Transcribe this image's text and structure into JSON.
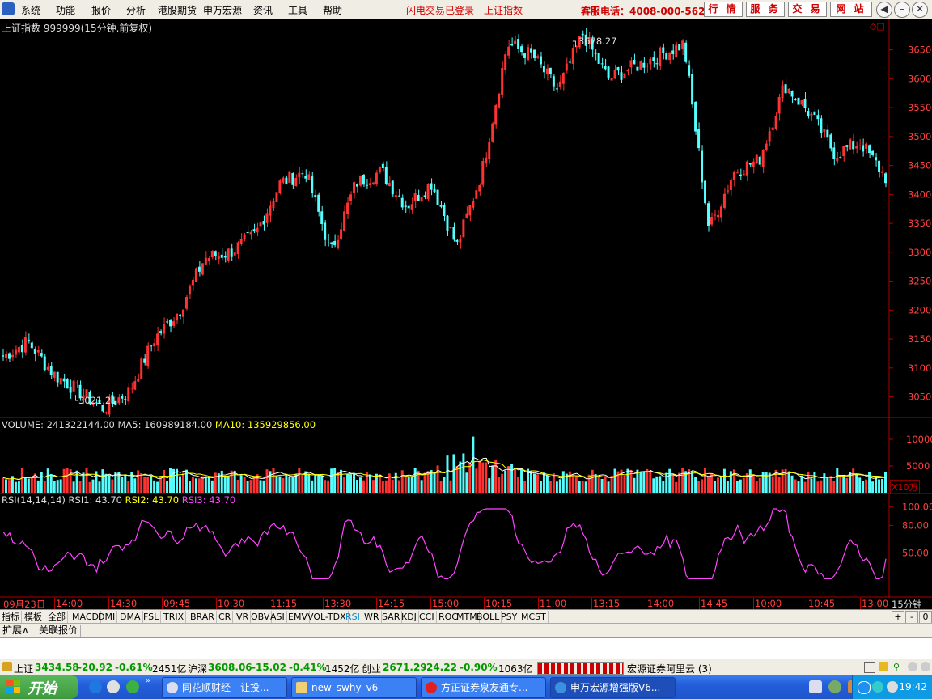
{
  "menu": {
    "items": [
      "系统",
      "功能",
      "报价",
      "分析",
      "港股期货",
      "申万宏源",
      "资讯",
      "工具",
      "帮助"
    ],
    "flash_login": "闪电交易已登录",
    "index_link": "上证指数",
    "hotline": "客服电话：4008-000-562",
    "buttons": [
      "行 情",
      "服 务",
      "交 易",
      "网 站"
    ]
  },
  "chart": {
    "stock_header": "上证指数 999999(15分钟.前复权)",
    "high_label": "3678.27",
    "low_label": "3021.21",
    "price_ticks": [
      "3650",
      "3600",
      "3550",
      "3500",
      "3450",
      "3400",
      "3350",
      "3300",
      "3250",
      "3200",
      "3150",
      "3100",
      "3050"
    ],
    "volume_header": {
      "vol": "VOLUME: 241322144.00",
      "ma5": "MA5: 160989184.00",
      "ma10": "MA10: 135929856.00"
    },
    "volume_ticks": [
      "10000",
      "5000"
    ],
    "volume_unit": "X10万",
    "rsi_header": {
      "params": "RSI(14,14,14)",
      "rsi1": "RSI1: 43.70",
      "rsi2": "RSI2: 43.70",
      "rsi3": "RSI3: 43.70"
    },
    "rsi_ticks": [
      "100.00",
      "80.00",
      "50.00"
    ],
    "time_labels": [
      "09月23日",
      "14:00",
      "14:30",
      "09:45",
      "10:30",
      "11:15",
      "13:30",
      "14:15",
      "15:00",
      "10:15",
      "11:00",
      "13:15",
      "14:00",
      "14:45",
      "10:00",
      "10:45",
      "13:00"
    ],
    "period": "15分钟",
    "colors": {
      "up": "#ff3232",
      "down": "#54ffff",
      "ma5": "#ffffff",
      "ma10": "#ffff00",
      "rsi": "#ff44ff",
      "axis": "#b00000"
    }
  },
  "chart_data": {
    "type": "candlestick",
    "title": "上证指数 999999(15分钟.前复权)",
    "high": 3678.27,
    "low": 3021.21,
    "close_path": [
      3120,
      3145,
      3090,
      3060,
      3030,
      3060,
      3150,
      3200,
      3290,
      3300,
      3330,
      3420,
      3440,
      3300,
      3420,
      3440,
      3380,
      3420,
      3310,
      3440,
      3660,
      3640,
      3580,
      3678,
      3600,
      3620,
      3640,
      3660,
      3340,
      3440,
      3460,
      3590,
      3540,
      3470,
      3490,
      3430
    ],
    "ylim": [
      3020,
      3690
    ],
    "last_volume": 241322144,
    "rsi": 43.7
  },
  "tabs": {
    "items": [
      "指标",
      "模板",
      "全部",
      "MACD",
      "DMI",
      "DMA",
      "FSL",
      "TRIX",
      "BRAR",
      "CR",
      "VR",
      "OBV",
      "ASI",
      "EMV",
      "VOL-TDX",
      "RSI",
      "WR",
      "SAR",
      "KDJ",
      "CCI",
      "ROC",
      "MTM",
      "BOLL",
      "PSY",
      "MCST"
    ],
    "active": "RSI",
    "right_buttons": [
      "+",
      "-",
      "0"
    ]
  },
  "ext": {
    "items": [
      "扩展∧",
      "关联报价"
    ]
  },
  "status": {
    "sh_name": "上证",
    "sh_value": "3434.58",
    "sh_change": "-20.92",
    "sh_pct": "-0.61%",
    "sh_amt": "2451亿",
    "hs_name": "沪深",
    "hs_value": "3608.06",
    "hs_change": "-15.02",
    "hs_pct": "-0.41%",
    "hs_amt": "1452亿",
    "cy_name": "创业",
    "cy_value": "2671.29",
    "cy_change": "-24.22",
    "cy_pct": "-0.90%",
    "cy_amt": "1063亿",
    "broker": "宏源证券阿里云 (3)"
  },
  "taskbar": {
    "start": "开始",
    "tasks": [
      "同花顺财经__让投...",
      "new_swhy_v6",
      "方正证券泉友通专...",
      "申万宏源增强版V6..."
    ],
    "time": "19:42"
  }
}
